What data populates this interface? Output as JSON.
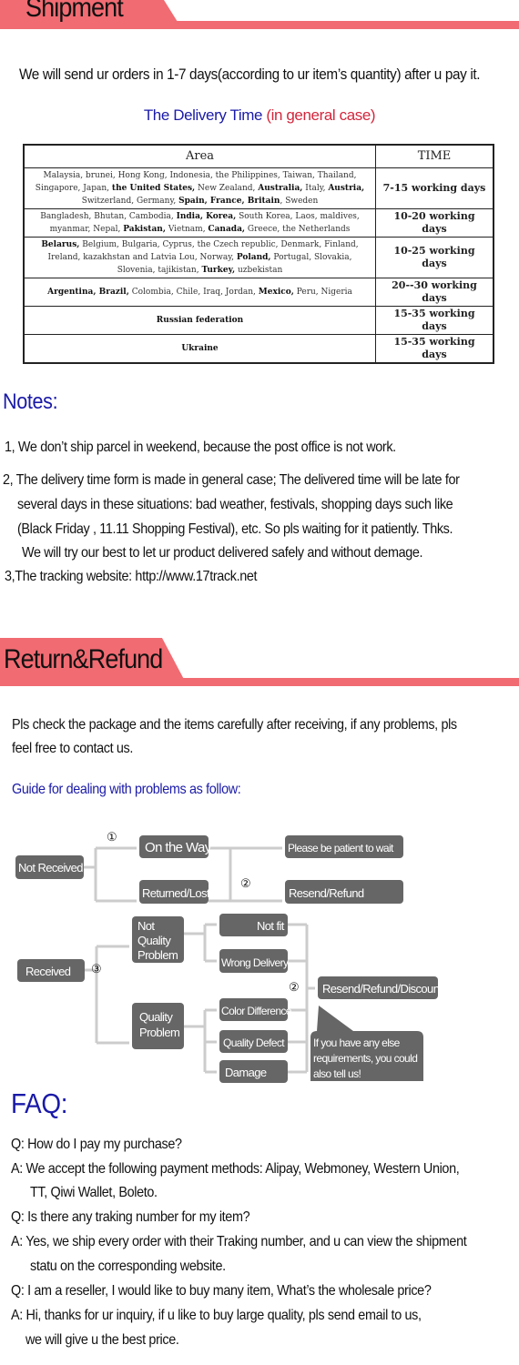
{
  "colors": {
    "accent": "#f16b72",
    "blue": "#1a1aa8",
    "red": "#d3263c",
    "box": "#666666"
  },
  "shipment": {
    "title": "Shipment",
    "intro": "We will send ur orders in 1-7 days(according to ur item’s quantity) after u pay it.",
    "delivery_title": "The Delivery Time",
    "delivery_note": "(in general case)",
    "table": {
      "headers": [
        "Area",
        "TIME"
      ],
      "rows": [
        {
          "area": [
            {
              "t": "Malaysia, brunei, Hong Kong, Indonesia, the Philippines, Taiwan, Thailand, Singapore, Japan, "
            },
            {
              "t": "the United States,",
              "b": true
            },
            {
              "t": " New Zealand, "
            },
            {
              "t": "Australia,",
              "b": true
            },
            {
              "t": " Italy, "
            },
            {
              "t": "Austria,",
              "b": true
            },
            {
              "t": " Switzerland, Germany, "
            },
            {
              "t": "Spain, France, Britain",
              "b": true
            },
            {
              "t": ", Sweden"
            }
          ],
          "time": "7-15 working days"
        },
        {
          "area": [
            {
              "t": "Bangladesh, Bhutan, Cambodia, "
            },
            {
              "t": "India, Korea,",
              "b": true
            },
            {
              "t": " South Korea, Laos, maldives, myanmar, Nepal, "
            },
            {
              "t": "Pakistan,",
              "b": true
            },
            {
              "t": " Vietnam, "
            },
            {
              "t": "Canada,",
              "b": true
            },
            {
              "t": " Greece, the Netherlands"
            }
          ],
          "time": "10-20 working days"
        },
        {
          "area": [
            {
              "t": "Belarus,",
              "b": true
            },
            {
              "t": " Belgium, Bulgaria, Cyprus, the Czech republic, Denmark, Finland, Ireland, kazakhstan and Latvia Lou, Norway, "
            },
            {
              "t": "Poland,",
              "b": true
            },
            {
              "t": " Portugal, Slovakia, Slovenia, tajikistan, "
            },
            {
              "t": "Turkey,",
              "b": true
            },
            {
              "t": " uzbekistan"
            }
          ],
          "time": "10-25 working days"
        },
        {
          "area": [
            {
              "t": "Argentina, Brazil,",
              "b": true
            },
            {
              "t": " Colombia, Chile, Iraq, Jordan, "
            },
            {
              "t": "Mexico,",
              "b": true
            },
            {
              "t": " Peru, Nigeria"
            }
          ],
          "time": "20--30 working days"
        },
        {
          "area": [
            {
              "t": "Russian federation",
              "b": true
            }
          ],
          "time": "15-35 working days"
        },
        {
          "area": [
            {
              "t": "Ukraine",
              "b": true
            }
          ],
          "time": "15-35 working days"
        }
      ]
    }
  },
  "notes": {
    "title": "Notes:",
    "lines": [
      "1, We don’t ship parcel in weekend, because the post office is not work.",
      "2, The delivery time form is made in general case; The delivered time will be late for",
      "several days in these situations: bad weather, festivals, shopping days such like",
      "(Black Friday , 11.11 Shopping Festival), etc. So pls waiting for it patiently. Thks.",
      "We will try our best to let ur product delivered safely and without demage.",
      "3,The tracking website: http://www.17track.net"
    ]
  },
  "refund": {
    "title": "Return&Refund",
    "lines": [
      "Pls check the package and the items carefully after receiving, if any problems, pls",
      "feel free to contact us."
    ],
    "guide": "Guide for dealing with problems as follow:",
    "flow": {
      "not_received": "Not Received",
      "on_the_way": "On the Way",
      "returned_lost": "Returned/Lost",
      "be_patient": "Please be patient to wait",
      "resend_refund": "Resend/Refund",
      "received": "Received",
      "not_quality": [
        "Not",
        "Quality",
        "Problem"
      ],
      "quality": [
        "Quality",
        "Problem"
      ],
      "not_fit": "Not fit",
      "wrong_delivery": "Wrong Delivery",
      "color_difference": "Color Difference",
      "quality_defect": "Quality Defect",
      "damage": "Damage",
      "resend_refund_discount": "Resend/Refund/Discount",
      "bubble": [
        "If you have any else",
        "requirements, you could",
        "also tell us!"
      ],
      "step1": "①",
      "step2": "②",
      "step3": "③"
    }
  },
  "faq": {
    "title": "FAQ:",
    "lines": [
      "Q: How do I pay my purchase?",
      "A: We accept the following payment methods: Alipay, Webmoney, Western Union,",
      "TT, Qiwi Wallet, Boleto.",
      "Q: Is there any traking number for my item?",
      "A: Yes, we ship every order with their Traking number, and u can view the shipment",
      "statu on the corresponding website.",
      "Q: I am a reseller, I would like to buy many item, What’s the wholesale price?",
      "A: Hi, thanks for ur inquiry, if u like to buy large quality, pls send email to us,",
      "we will give u the best price."
    ]
  }
}
